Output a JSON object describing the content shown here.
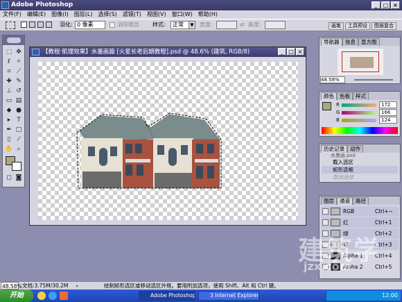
{
  "app": {
    "title": "Adobe Photoshop"
  },
  "menu": [
    "文件(F)",
    "编辑(E)",
    "图像(I)",
    "图层(L)",
    "选择(S)",
    "滤镜(T)",
    "视图(V)",
    "窗口(W)",
    "帮助(H)"
  ],
  "options": {
    "feather_label": "羽化:",
    "feather_value": "0 像素",
    "antialias_label": "消除锯齿",
    "style_label": "样式:",
    "style_value": "正常",
    "width_label": "宽度:",
    "height_label": "高度:",
    "tabs": [
      "画笔",
      "工具预设",
      "图层复合"
    ]
  },
  "document": {
    "title": "【教程·肌理效果】水墨画篇 [火星长老后期教程].psd @ 48.6% (建筑, RGB/8)"
  },
  "navigator": {
    "tabs": [
      "导航器",
      "信息",
      "直方图"
    ],
    "zoom": "48.58%"
  },
  "color": {
    "tabs": [
      "颜色",
      "色板",
      "样式"
    ],
    "channels": [
      {
        "label": "R",
        "value": "172"
      },
      {
        "label": "G",
        "value": "166"
      },
      {
        "label": "B",
        "value": "124"
      }
    ],
    "fg": "#aca67c"
  },
  "history": {
    "tabs": [
      "历史记录",
      "动作"
    ],
    "source": "水墨画.psd",
    "items": [
      "载入选区",
      "矩形选框",
      "取消选择"
    ]
  },
  "layers": {
    "tabs": [
      "图层",
      "通道",
      "路径"
    ],
    "channels": [
      {
        "name": "RGB",
        "shortcut": "Ctrl+~"
      },
      {
        "name": "红",
        "shortcut": "Ctrl+1"
      },
      {
        "name": "绿",
        "shortcut": "Ctrl+2"
      },
      {
        "name": "蓝",
        "shortcut": "Ctrl+3"
      },
      {
        "name": "Alpha 1",
        "shortcut": "Ctrl+4"
      },
      {
        "name": "Alpha 2",
        "shortcut": "Ctrl+5"
      }
    ]
  },
  "status": {
    "zoom": "48.58%",
    "doc": "文档:3.75M/30.2M",
    "hint": "绘制矩形选区或移动选区外框。要用附加选项，使用 Shift、Alt 和 Ctrl 键。"
  },
  "taskbar": {
    "start": "开始",
    "tasks": [
      "Adobe Photoshop",
      "3 Internet Explorer"
    ],
    "clock": "12:00"
  },
  "watermark": {
    "main": "建筑学",
    "sub": "jzx.com"
  }
}
